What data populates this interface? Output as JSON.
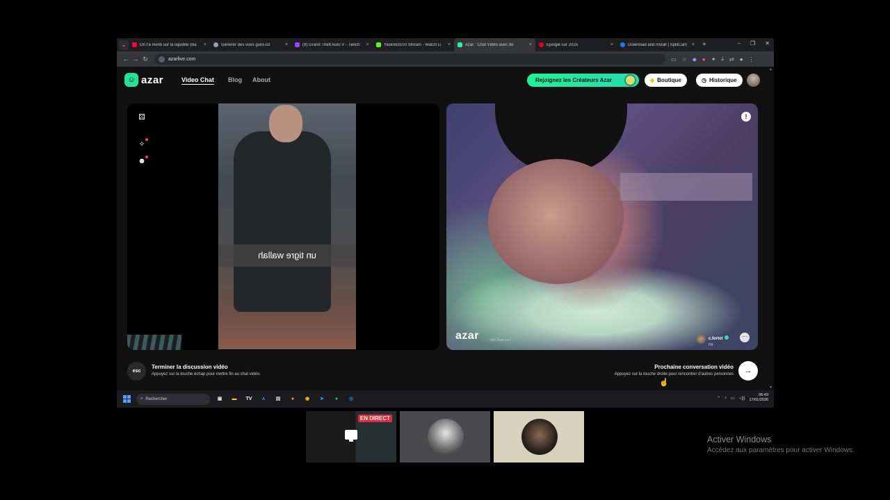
{
  "browser": {
    "tabs": [
      {
        "label": "On t'a menti sur la liquidité (Ba",
        "color": "#ff0033"
      },
      {
        "label": "Générer des vues guns.lol",
        "color": "#9aa0a6"
      },
      {
        "label": "(9) Grand Theft Auto V - Twitch",
        "color": "#9146ff"
      },
      {
        "label": "Yasko93100 Stream - Watch Li",
        "color": "#53fc18"
      },
      {
        "label": "Azar : Chat Vidéo avec de",
        "color": "#1ef29a",
        "active": true
      },
      {
        "label": "Épinglé sur 2025",
        "color": "#e60023"
      },
      {
        "label": "Download and Install | SplitCam",
        "color": "#2f6bff"
      }
    ],
    "tab_close": "×",
    "new_tab": "+",
    "window_controls": [
      "–",
      "❐",
      "✕"
    ],
    "url": "azarlive.com"
  },
  "azar": {
    "logo_text": "azar",
    "logo_mark": "☺",
    "nav": [
      "Video Chat",
      "Blog",
      "About"
    ],
    "creators_button": "Rejoignez les Créateurs Azar",
    "shop_button": "Boutique",
    "history_button": "Historique",
    "camera_caption": "un tigre wallah",
    "watermark": "azar",
    "watermark_sub": "001 Azar s.r.l",
    "peer_name": "c.fortot",
    "peer_country": "FR",
    "more_label": "···",
    "report_label": "!",
    "esc_key": "esc",
    "end_title": "Terminer la discussion vidéo",
    "end_subtitle": "Appuyez sur la touche échap pour mettre fin au chat vidéo.",
    "next_title": "Prochaine conversation vidéo",
    "next_subtitle": "Appuyez sur la touche droite pour rencontrer d'autres personnes",
    "next_arrow": "→",
    "accent_color": "#1ef29a"
  },
  "taskbar": {
    "search_placeholder": "Rechercher",
    "time": "06:43",
    "date": "17/01/2026"
  },
  "call": {
    "live_badge": "EN DIRECT"
  },
  "windows_activation": {
    "title": "Activer Windows",
    "subtitle": "Accédez aux paramètres pour activer Windows."
  }
}
